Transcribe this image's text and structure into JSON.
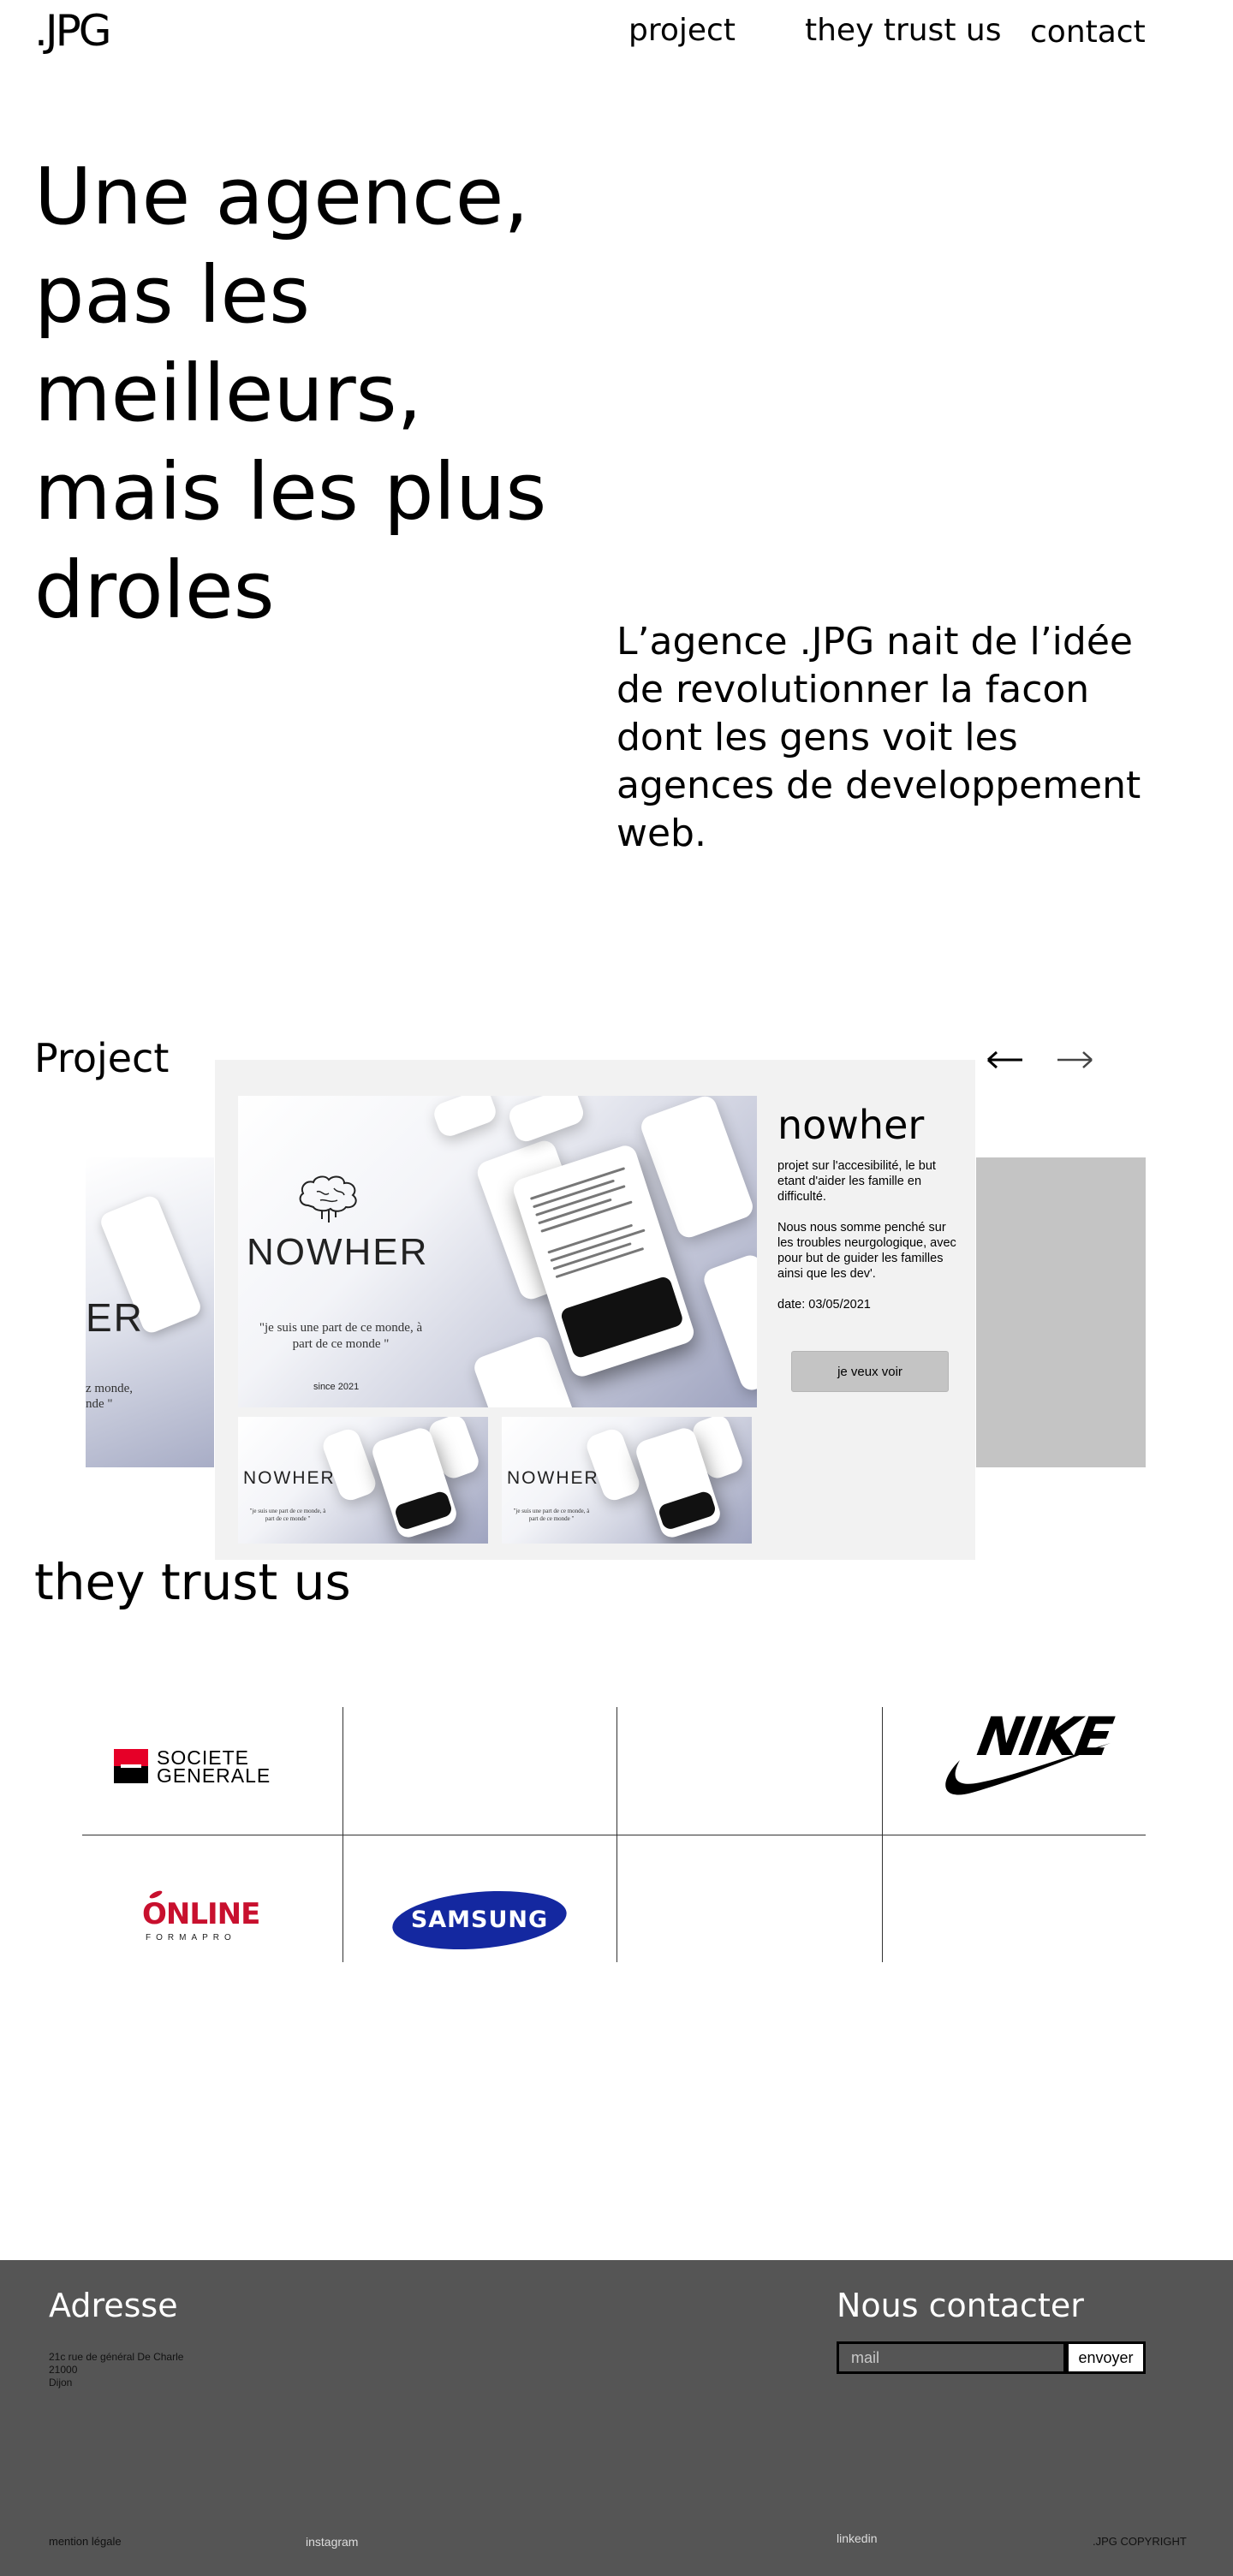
{
  "header": {
    "logo": ".JPG",
    "nav": [
      "project",
      "they trust us",
      "contact"
    ]
  },
  "hero": {
    "title": "Une agence, pas les meilleurs, mais les plus droles",
    "intro": "L’agence .JPG nait de l’idée de revolutionner la facon dont les gens voit les agences de developpement web."
  },
  "projects": {
    "title": "Project",
    "prev_icon": "arrow-left-icon",
    "next_icon": "arrow-right-icon",
    "current": {
      "name": "nowher",
      "description_1": "projet sur l'accesibilité, le but etant d'aider les famille en difficulté.",
      "description_2": "Nous nous somme penché sur les troubles neurgologique, avec pour but de guider les familles ainsi que les dev'.",
      "date": "date: 03/05/2021",
      "button": "je veux voir",
      "image": {
        "brand": "NOWHER",
        "quote": "\"je suis une part de ce monde, à part de ce monde \"",
        "since": "since 2021"
      }
    },
    "prev_slide": {
      "brand_fragment": "ER",
      "quote_fragment_1": "z monde,",
      "quote_fragment_2": "nde \""
    }
  },
  "trust": {
    "title": "they trust us",
    "logos": [
      {
        "name": "SOCIETE GENERALE",
        "line1": "SOCIETE",
        "line2": "GENERALE",
        "color": "#e60028"
      },
      {
        "name": "NIKE",
        "text": "NIKE"
      },
      {
        "name": "ONLINE FORMAPRO",
        "text": "ONLINE",
        "sub": "FORMAPRO",
        "color": "#c8102e"
      },
      {
        "name": "SAMSUNG",
        "text": "SAMSUNG",
        "color": "#1428a0"
      }
    ]
  },
  "footer": {
    "address_title": "Adresse",
    "address_lines": [
      "21c rue de général De Charle",
      "21000",
      "Dijon"
    ],
    "contact_title": "Nous contacter",
    "mail_placeholder": "mail",
    "send_button": "envoyer",
    "links": {
      "legal": "mention légale",
      "instagram": "instagram",
      "linkedin": "linkedin",
      "copyright": ".JPG COPYRIGHT"
    },
    "background": "#555555"
  }
}
